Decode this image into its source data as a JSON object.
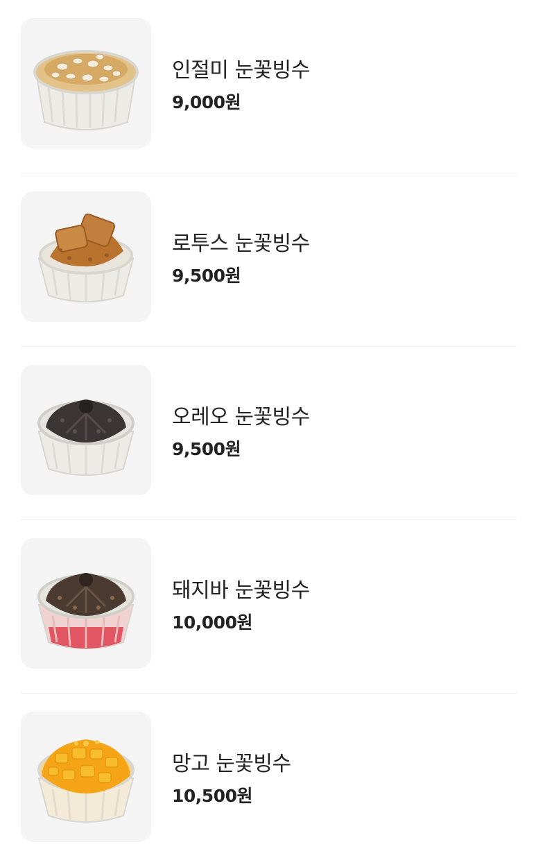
{
  "menu": {
    "items": [
      {
        "name": "인절미 눈꽃빙수",
        "price": "9,000원",
        "image_icon": "injeolmi-bingsu-icon",
        "topping_color": "#d9a762"
      },
      {
        "name": "로투스 눈꽃빙수",
        "price": "9,500원",
        "image_icon": "lotus-bingsu-icon",
        "topping_color": "#b06a2b"
      },
      {
        "name": "오레오 눈꽃빙수",
        "price": "9,500원",
        "image_icon": "oreo-bingsu-icon",
        "topping_color": "#3a3434"
      },
      {
        "name": "돼지바 눈꽃빙수",
        "price": "10,000원",
        "image_icon": "dwaejibar-bingsu-icon",
        "topping_color": "#3d302a"
      },
      {
        "name": "망고 눈꽃빙수",
        "price": "10,500원",
        "image_icon": "mango-bingsu-icon",
        "topping_color": "#f4a414"
      }
    ]
  }
}
